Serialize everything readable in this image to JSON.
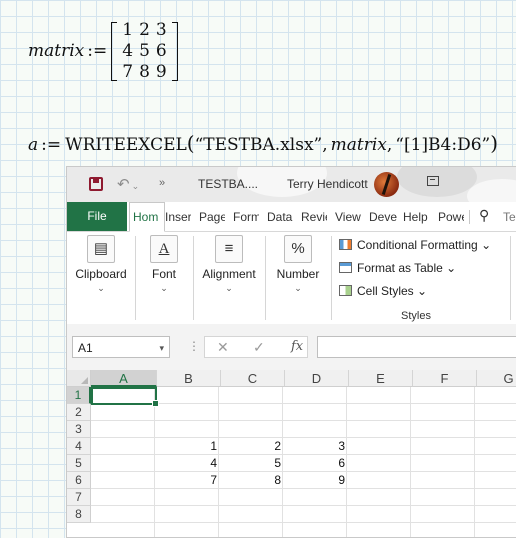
{
  "math": {
    "matrix_name": "matrix",
    "assign_op": ":=",
    "matrix_rows": [
      [
        "1",
        "2",
        "3"
      ],
      [
        "4",
        "5",
        "6"
      ],
      [
        "7",
        "8",
        "9"
      ]
    ],
    "formula_lhs": "a",
    "formula_func": "WRITEEXCEL",
    "formula_open": "(",
    "formula_arg1": "“TESTBA.xlsx”",
    "formula_comma": ",",
    "formula_arg2": "matrix",
    "formula_arg3": "“[1]B4:D6”",
    "formula_close": ")"
  },
  "excel": {
    "titlebar": {
      "undo_icon": "undo-icon",
      "more_icon": "»",
      "filename": "TESTBA....",
      "user": "Terry Hendicott"
    },
    "tabs": {
      "file": "File",
      "items": [
        "Hom",
        "Inser",
        "Page",
        "Form",
        "Data",
        "Revie",
        "View",
        "Deve",
        "Help",
        "Powe"
      ],
      "lightbulb": "⚲",
      "tell_me": "Te"
    },
    "ribbon": {
      "clipboard": "Clipboard",
      "font": "Font",
      "alignment": "Alignment",
      "number": "Number",
      "number_icon": "%",
      "conditional_formatting": "Conditional Formatting",
      "format_as_table": "Format as Table",
      "cell_styles": "Cell Styles",
      "styles": "Styles",
      "dropdown": "⌄"
    },
    "formula_bar": {
      "name_box": "A1",
      "name_box_arrow": "▾",
      "dots": "⋮",
      "cancel": "✕",
      "enter": "✓",
      "fx": "fx",
      "value": ""
    },
    "columns": [
      "A",
      "B",
      "C",
      "D",
      "E",
      "F",
      "G"
    ],
    "rows": [
      "1",
      "2",
      "3",
      "4",
      "5",
      "6",
      "7",
      "8"
    ],
    "selected_cell": "A1",
    "cells": [
      {
        "ref": "B4",
        "value": "1"
      },
      {
        "ref": "C4",
        "value": "2"
      },
      {
        "ref": "D4",
        "value": "3"
      },
      {
        "ref": "B5",
        "value": "4"
      },
      {
        "ref": "C5",
        "value": "5"
      },
      {
        "ref": "D5",
        "value": "6"
      },
      {
        "ref": "B6",
        "value": "7"
      },
      {
        "ref": "C6",
        "value": "8"
      },
      {
        "ref": "D6",
        "value": "9"
      }
    ],
    "colors": {
      "accent": "#217346",
      "brand_dark_red": "#8f1a30"
    }
  }
}
